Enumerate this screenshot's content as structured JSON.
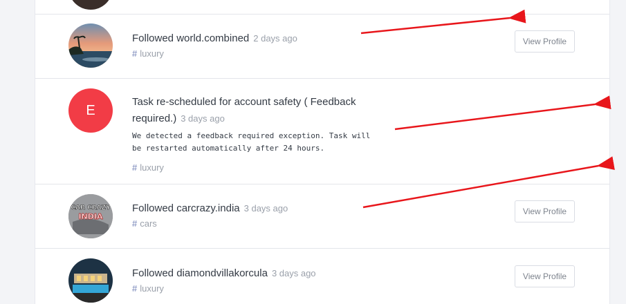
{
  "colors": {
    "accent_red": "#f23c46",
    "annotation_red": "#e8161b",
    "tag_hash": "#6f7fb5"
  },
  "items": [
    {
      "action": "Followed world.combined",
      "time": "2 days ago",
      "tag": "luxury",
      "button": "View Profile",
      "avatar_icon": "sunset-beach-photo"
    },
    {
      "action": "Task re-scheduled for account safety ( Feedback required.)",
      "time": "3 days ago",
      "message": "We detected a feedback required exception. Task will be restarted automatically after 24 hours.",
      "tag": "luxury",
      "avatar_letter": "E"
    },
    {
      "action": "Followed carcrazy.india",
      "time": "3 days ago",
      "tag": "cars",
      "button": "View Profile",
      "avatar_icon": "car-crazy-india-logo",
      "avatar_text_lines": [
        "CAR CRAZY",
        "INDIA"
      ]
    },
    {
      "action": "Followed diamondvillakorcula",
      "time": "3 days ago",
      "tag": "luxury",
      "button": "View Profile",
      "avatar_icon": "villa-photo"
    }
  ],
  "tag_symbol": "#"
}
